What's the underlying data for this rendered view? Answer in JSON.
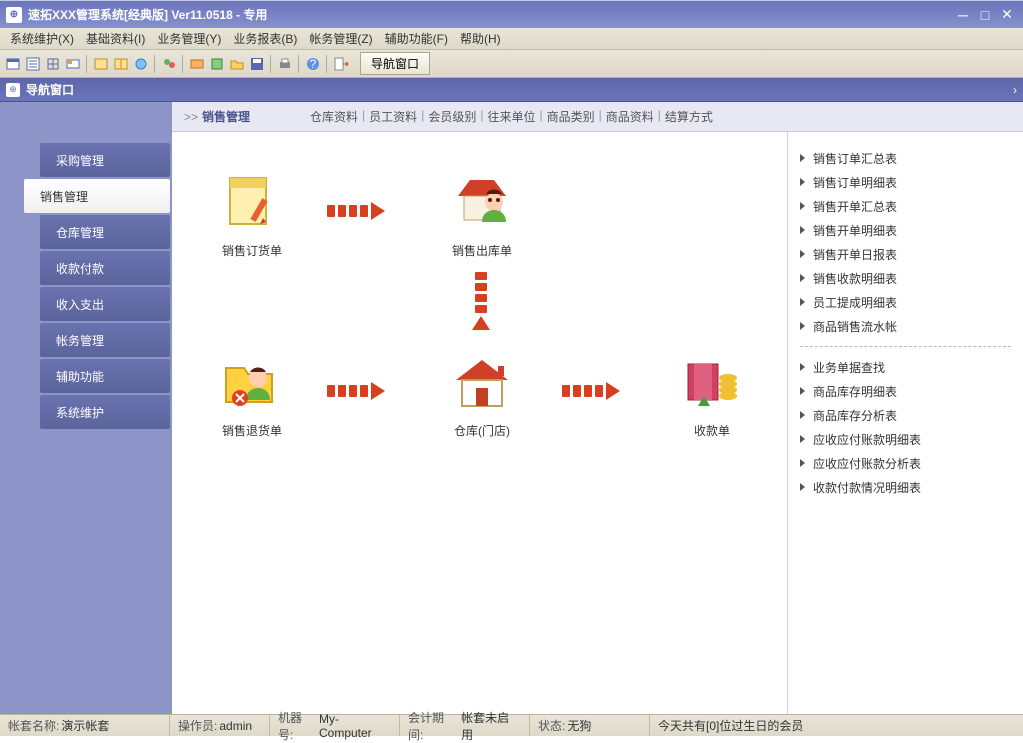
{
  "window": {
    "title": "速拓XXX管理系统[经典版]  Ver11.0518  -  专用"
  },
  "menubar": [
    "系统维护(X)",
    "基础资料(I)",
    "业务管理(Y)",
    "业务报表(B)",
    "帐务管理(Z)",
    "辅助功能(F)",
    "帮助(H)"
  ],
  "toolbar": {
    "nav_button": "导航窗口"
  },
  "panel": {
    "title": "导航窗口"
  },
  "sidebar": {
    "items": [
      {
        "label": "采购管理",
        "active": false
      },
      {
        "label": "销售管理",
        "active": true
      },
      {
        "label": "仓库管理",
        "active": false
      },
      {
        "label": "收款付款",
        "active": false
      },
      {
        "label": "收入支出",
        "active": false
      },
      {
        "label": "帐务管理",
        "active": false
      },
      {
        "label": "辅助功能",
        "active": false
      },
      {
        "label": "系统维护",
        "active": false
      }
    ]
  },
  "breadcrumb": {
    "prefix": ">>",
    "current": "销售管理",
    "links": [
      "仓库资料",
      "员工资料",
      "会员级别",
      "往来单位",
      "商品类别",
      "商品资料",
      "结算方式"
    ]
  },
  "nodes": {
    "order": "销售订货单",
    "out": "销售出库单",
    "return": "销售退货单",
    "store": "仓库(门店)",
    "collect": "收款单"
  },
  "rightpanel": {
    "group1": [
      "销售订单汇总表",
      "销售订单明细表",
      "销售开单汇总表",
      "销售开单明细表",
      "销售开单日报表",
      "销售收款明细表",
      "员工提成明细表",
      "商品销售流水帐"
    ],
    "group2": [
      "业务单据查找",
      "商品库存明细表",
      "商品库存分析表",
      "应收应付账款明细表",
      "应收应付账款分析表",
      "收款付款情况明细表"
    ]
  },
  "statusbar": {
    "account_label": "帐套名称:",
    "account_value": "演示帐套",
    "operator_label": "操作员:",
    "operator_value": "admin",
    "machine_label": "机器号:",
    "machine_value": "My-Computer",
    "period_label": "会计期间:",
    "period_value": "帐套未启用",
    "state_label": "状态:",
    "state_value": "无狗",
    "birthday": "今天共有[0]位过生日的会员"
  }
}
